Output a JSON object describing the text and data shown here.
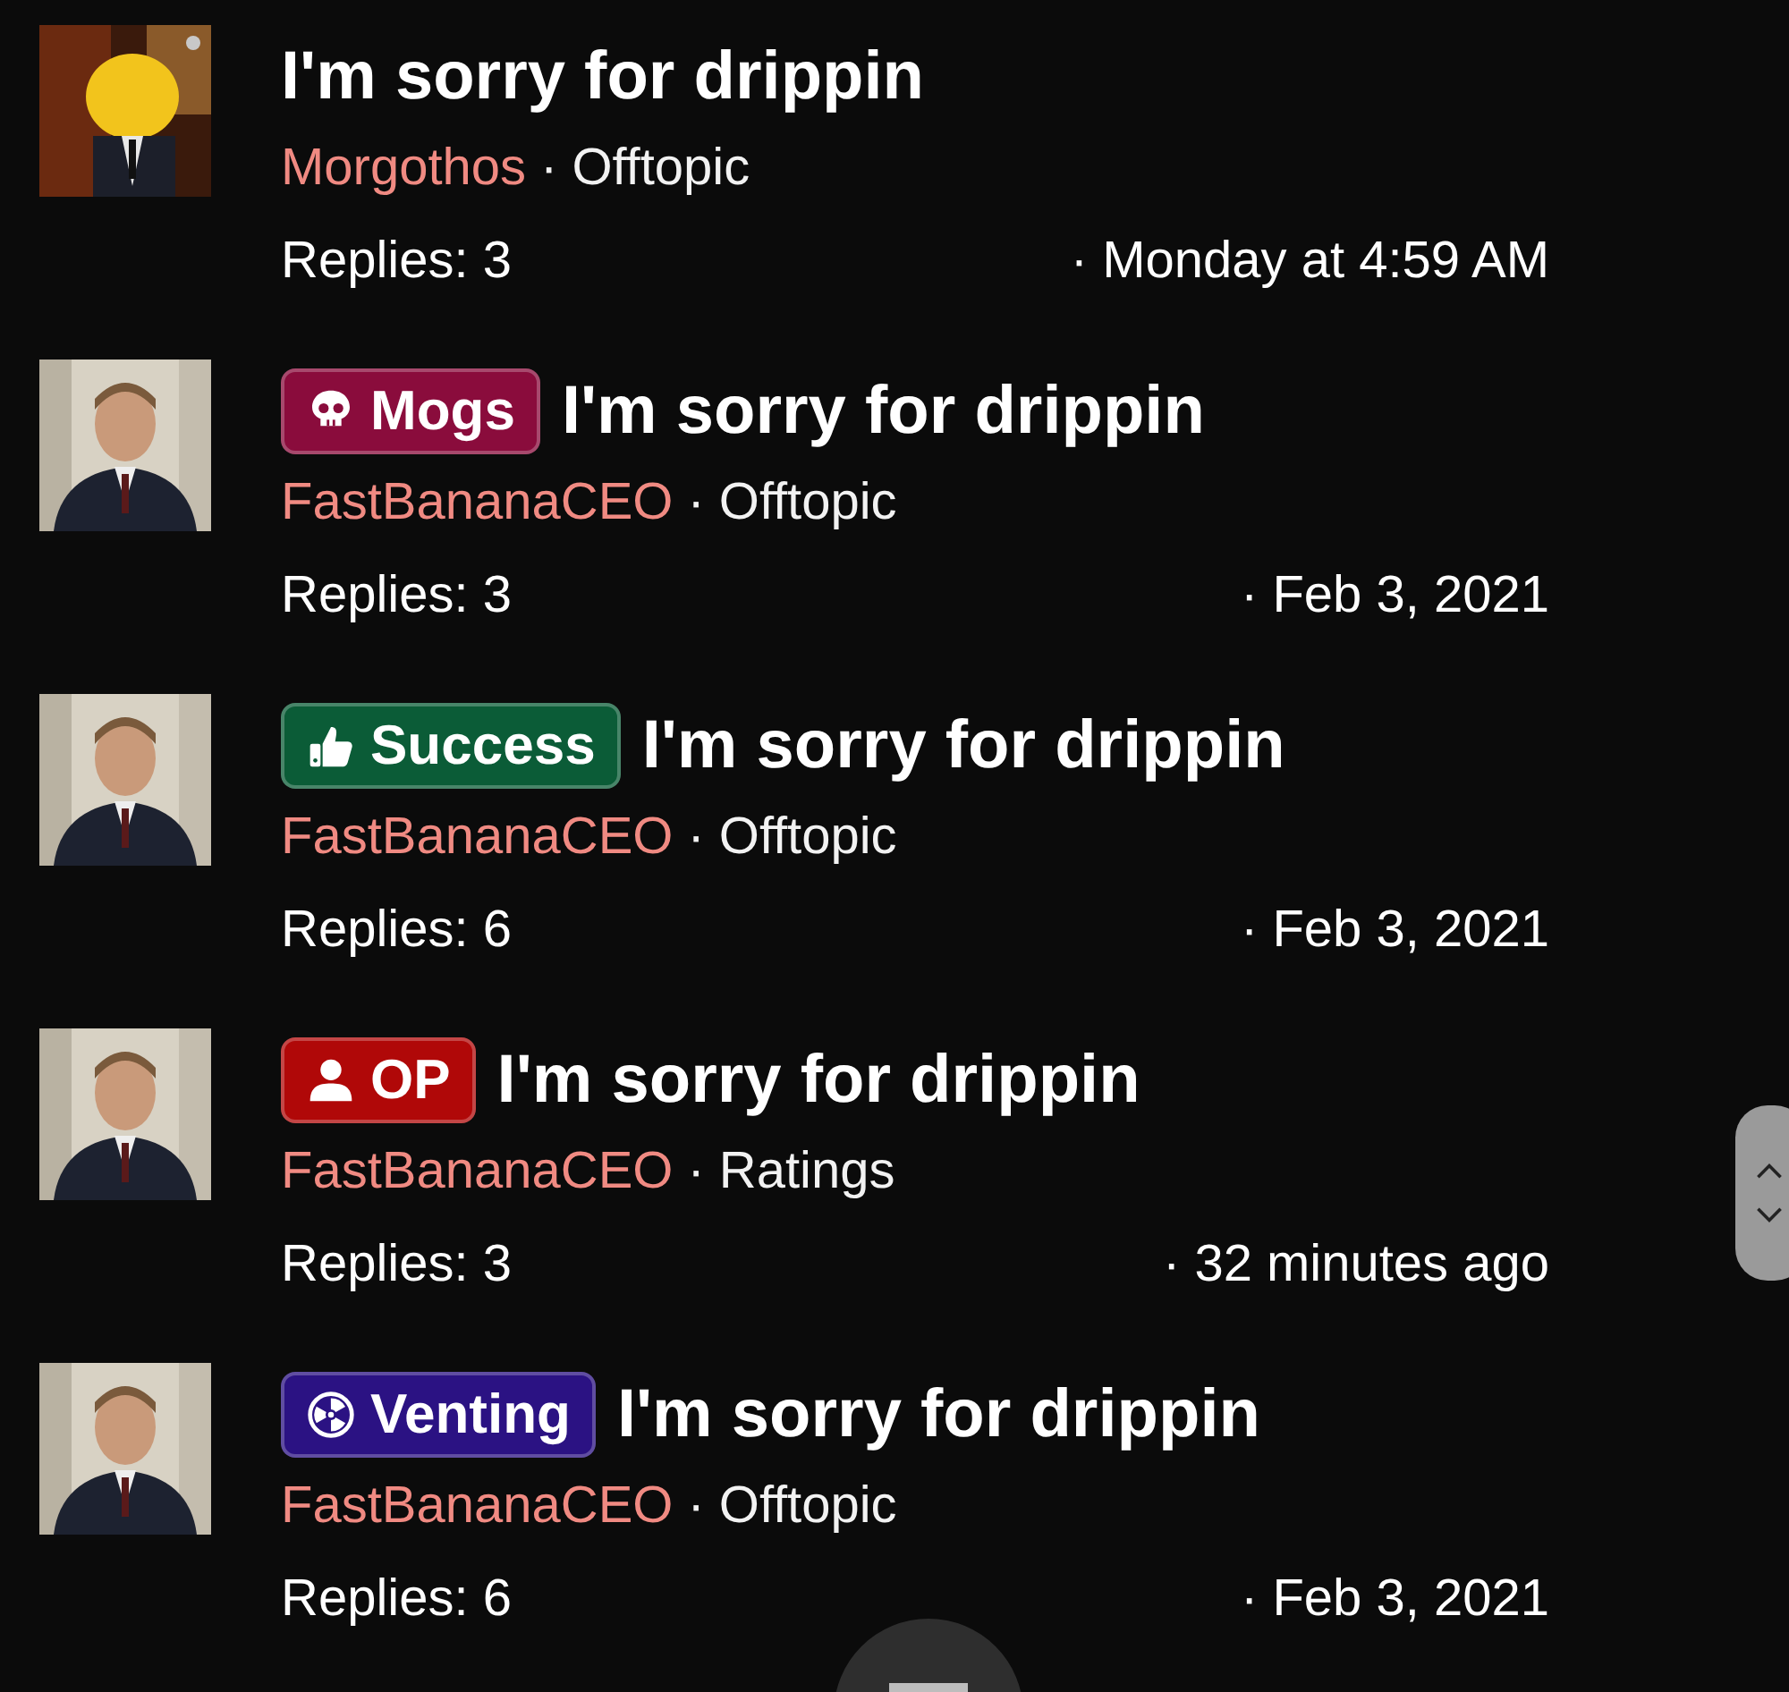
{
  "threads": [
    {
      "title": "I'm sorry for drippin",
      "author": "Morgothos",
      "separator": "·",
      "forum": "Offtopic",
      "replies": "Replies: 3",
      "date": "· Monday at 4:59 AM"
    },
    {
      "prefix": {
        "kind": "skull",
        "label": "Mogs",
        "color": "#8a0c3c"
      },
      "title": "I'm sorry for drippin",
      "author": "FastBananaCEO",
      "separator": "·",
      "forum": "Offtopic",
      "replies": "Replies: 3",
      "date": "· Feb 3, 2021"
    },
    {
      "prefix": {
        "kind": "thumbs-up",
        "label": "Success",
        "color": "#0b5c37"
      },
      "title": "I'm sorry for drippin",
      "author": "FastBananaCEO",
      "separator": "·",
      "forum": "Offtopic",
      "replies": "Replies: 6",
      "date": "· Feb 3, 2021"
    },
    {
      "prefix": {
        "kind": "person",
        "label": "OP",
        "color": "#b00808"
      },
      "title": "I'm sorry for drippin",
      "author": "FastBananaCEO",
      "separator": "·",
      "forum": "Ratings",
      "replies": "Replies: 3",
      "date": "· 32 minutes ago"
    },
    {
      "prefix": {
        "kind": "radiation",
        "label": "Venting",
        "color": "#2b1283"
      },
      "title": "I'm sorry for drippin",
      "author": "FastBananaCEO",
      "separator": "·",
      "forum": "Offtopic",
      "replies": "Replies: 6",
      "date": "· Feb 3, 2021"
    }
  ]
}
